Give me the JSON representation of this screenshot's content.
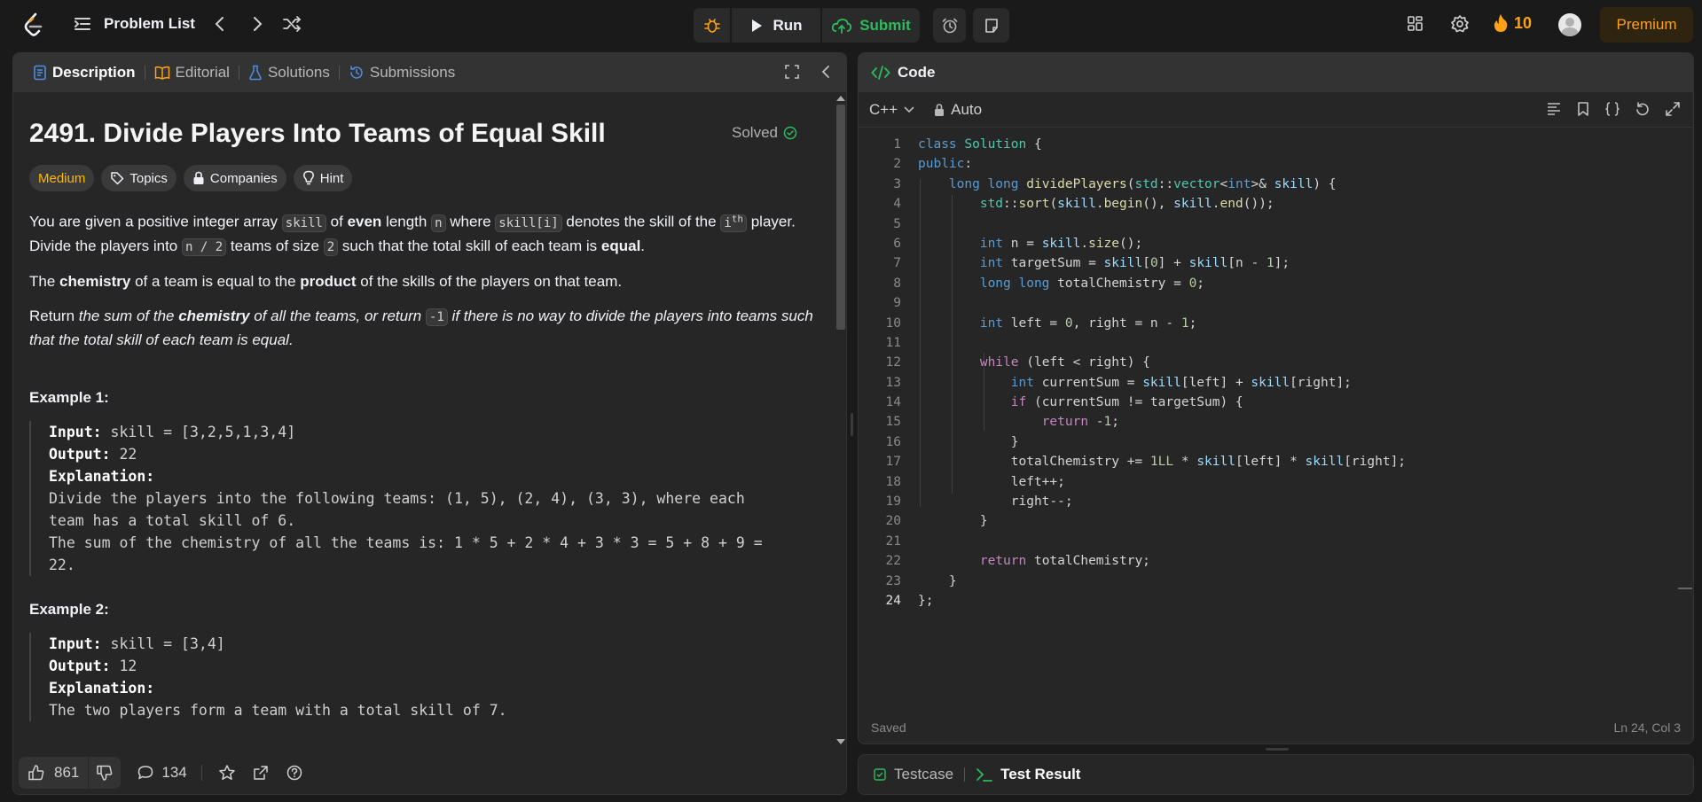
{
  "topbar": {
    "problem_list_label": "Problem List",
    "run_label": "Run",
    "submit_label": "Submit",
    "streak_count": "10",
    "premium_label": "Premium"
  },
  "colors": {
    "accent_orange": "#ffa116",
    "success_green": "#2cbb5d",
    "medium_yellow": "#ffb800",
    "panel_bg": "#262626",
    "app_bg": "#1a1a1a"
  },
  "description_panel": {
    "tabs": [
      "Description",
      "Editorial",
      "Solutions",
      "Submissions"
    ],
    "title": "2491. Divide Players Into Teams of Equal Skill",
    "solved_label": "Solved",
    "chips": {
      "difficulty": "Medium",
      "topics": "Topics",
      "companies": "Companies",
      "hint": "Hint"
    },
    "para1": {
      "t1": "You are given a positive integer array ",
      "c1": "skill",
      "t2": " of ",
      "b1": "even",
      "t3": " length ",
      "c2": "n",
      "t4": " where ",
      "c3": "skill[i]",
      "t5": " denotes the skill of the ",
      "c4": "i",
      "sup": "th",
      "t6": " player. Divide the players into ",
      "c5": "n / 2",
      "t7": " teams of size ",
      "c6": "2",
      "t8": " such that the total skill of each team is ",
      "b2": "equal",
      "t9": "."
    },
    "para2": {
      "t1": "The ",
      "b1": "chemistry",
      "t2": " of a team is equal to the ",
      "b2": "product",
      "t3": " of the skills of the players on that team."
    },
    "para3": {
      "t1": "Return ",
      "i1": "the sum of the ",
      "b1": "chemistry",
      "i2": " of all the teams, or return ",
      "c1": "-1",
      "i3": " if there is no way to divide the players into teams such that the total skill of each team is equal."
    },
    "example1": {
      "heading": "Example 1:",
      "input_label": "Input:",
      "input": "skill = [3,2,5,1,3,4]",
      "output_label": "Output:",
      "output": "22",
      "explanation_label": "Explanation:",
      "explanation_lines": [
        "Divide the players into the following teams: (1, 5), (2, 4), (3, 3), where each",
        "team has a total skill of 6.",
        "The sum of the chemistry of all the teams is: 1 * 5 + 2 * 4 + 3 * 3 = 5 + 8 + 9 =",
        "22."
      ]
    },
    "example2": {
      "heading": "Example 2:",
      "input_label": "Input:",
      "input": "skill = [3,4]",
      "output_label": "Output:",
      "output": "12",
      "explanation_label": "Explanation:",
      "explanation_lines": [
        "The two players form a team with a total skill of 7."
      ]
    },
    "footer": {
      "likes": "861",
      "comments": "134"
    }
  },
  "code_panel": {
    "title": "Code",
    "language": "C++",
    "mode": "Auto",
    "status": "Saved",
    "cursor": "Ln 24, Col 3",
    "current_line": 24
  },
  "bottom_panel": {
    "tabs": [
      "Testcase",
      "Test Result"
    ]
  }
}
